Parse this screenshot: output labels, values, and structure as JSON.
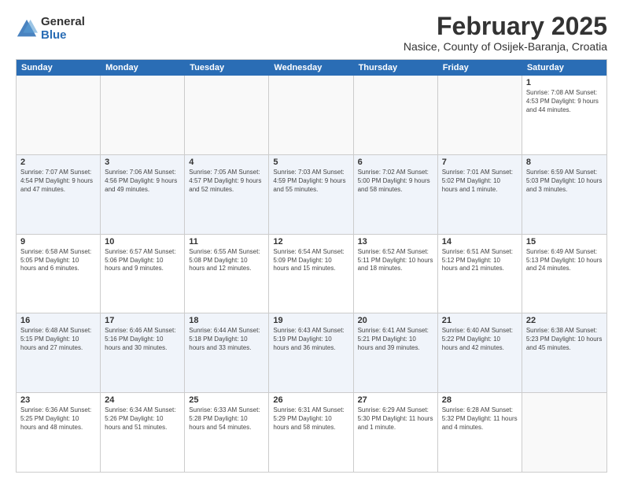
{
  "logo": {
    "general": "General",
    "blue": "Blue"
  },
  "header": {
    "month": "February 2025",
    "location": "Nasice, County of Osijek-Baranja, Croatia"
  },
  "weekdays": [
    "Sunday",
    "Monday",
    "Tuesday",
    "Wednesday",
    "Thursday",
    "Friday",
    "Saturday"
  ],
  "rows": [
    [
      {
        "day": "",
        "text": ""
      },
      {
        "day": "",
        "text": ""
      },
      {
        "day": "",
        "text": ""
      },
      {
        "day": "",
        "text": ""
      },
      {
        "day": "",
        "text": ""
      },
      {
        "day": "",
        "text": ""
      },
      {
        "day": "1",
        "text": "Sunrise: 7:08 AM\nSunset: 4:53 PM\nDaylight: 9 hours\nand 44 minutes."
      }
    ],
    [
      {
        "day": "2",
        "text": "Sunrise: 7:07 AM\nSunset: 4:54 PM\nDaylight: 9 hours\nand 47 minutes."
      },
      {
        "day": "3",
        "text": "Sunrise: 7:06 AM\nSunset: 4:56 PM\nDaylight: 9 hours\nand 49 minutes."
      },
      {
        "day": "4",
        "text": "Sunrise: 7:05 AM\nSunset: 4:57 PM\nDaylight: 9 hours\nand 52 minutes."
      },
      {
        "day": "5",
        "text": "Sunrise: 7:03 AM\nSunset: 4:59 PM\nDaylight: 9 hours\nand 55 minutes."
      },
      {
        "day": "6",
        "text": "Sunrise: 7:02 AM\nSunset: 5:00 PM\nDaylight: 9 hours\nand 58 minutes."
      },
      {
        "day": "7",
        "text": "Sunrise: 7:01 AM\nSunset: 5:02 PM\nDaylight: 10 hours\nand 1 minute."
      },
      {
        "day": "8",
        "text": "Sunrise: 6:59 AM\nSunset: 5:03 PM\nDaylight: 10 hours\nand 3 minutes."
      }
    ],
    [
      {
        "day": "9",
        "text": "Sunrise: 6:58 AM\nSunset: 5:05 PM\nDaylight: 10 hours\nand 6 minutes."
      },
      {
        "day": "10",
        "text": "Sunrise: 6:57 AM\nSunset: 5:06 PM\nDaylight: 10 hours\nand 9 minutes."
      },
      {
        "day": "11",
        "text": "Sunrise: 6:55 AM\nSunset: 5:08 PM\nDaylight: 10 hours\nand 12 minutes."
      },
      {
        "day": "12",
        "text": "Sunrise: 6:54 AM\nSunset: 5:09 PM\nDaylight: 10 hours\nand 15 minutes."
      },
      {
        "day": "13",
        "text": "Sunrise: 6:52 AM\nSunset: 5:11 PM\nDaylight: 10 hours\nand 18 minutes."
      },
      {
        "day": "14",
        "text": "Sunrise: 6:51 AM\nSunset: 5:12 PM\nDaylight: 10 hours\nand 21 minutes."
      },
      {
        "day": "15",
        "text": "Sunrise: 6:49 AM\nSunset: 5:13 PM\nDaylight: 10 hours\nand 24 minutes."
      }
    ],
    [
      {
        "day": "16",
        "text": "Sunrise: 6:48 AM\nSunset: 5:15 PM\nDaylight: 10 hours\nand 27 minutes."
      },
      {
        "day": "17",
        "text": "Sunrise: 6:46 AM\nSunset: 5:16 PM\nDaylight: 10 hours\nand 30 minutes."
      },
      {
        "day": "18",
        "text": "Sunrise: 6:44 AM\nSunset: 5:18 PM\nDaylight: 10 hours\nand 33 minutes."
      },
      {
        "day": "19",
        "text": "Sunrise: 6:43 AM\nSunset: 5:19 PM\nDaylight: 10 hours\nand 36 minutes."
      },
      {
        "day": "20",
        "text": "Sunrise: 6:41 AM\nSunset: 5:21 PM\nDaylight: 10 hours\nand 39 minutes."
      },
      {
        "day": "21",
        "text": "Sunrise: 6:40 AM\nSunset: 5:22 PM\nDaylight: 10 hours\nand 42 minutes."
      },
      {
        "day": "22",
        "text": "Sunrise: 6:38 AM\nSunset: 5:23 PM\nDaylight: 10 hours\nand 45 minutes."
      }
    ],
    [
      {
        "day": "23",
        "text": "Sunrise: 6:36 AM\nSunset: 5:25 PM\nDaylight: 10 hours\nand 48 minutes."
      },
      {
        "day": "24",
        "text": "Sunrise: 6:34 AM\nSunset: 5:26 PM\nDaylight: 10 hours\nand 51 minutes."
      },
      {
        "day": "25",
        "text": "Sunrise: 6:33 AM\nSunset: 5:28 PM\nDaylight: 10 hours\nand 54 minutes."
      },
      {
        "day": "26",
        "text": "Sunrise: 6:31 AM\nSunset: 5:29 PM\nDaylight: 10 hours\nand 58 minutes."
      },
      {
        "day": "27",
        "text": "Sunrise: 6:29 AM\nSunset: 5:30 PM\nDaylight: 11 hours\nand 1 minute."
      },
      {
        "day": "28",
        "text": "Sunrise: 6:28 AM\nSunset: 5:32 PM\nDaylight: 11 hours\nand 4 minutes."
      },
      {
        "day": "",
        "text": ""
      }
    ]
  ]
}
